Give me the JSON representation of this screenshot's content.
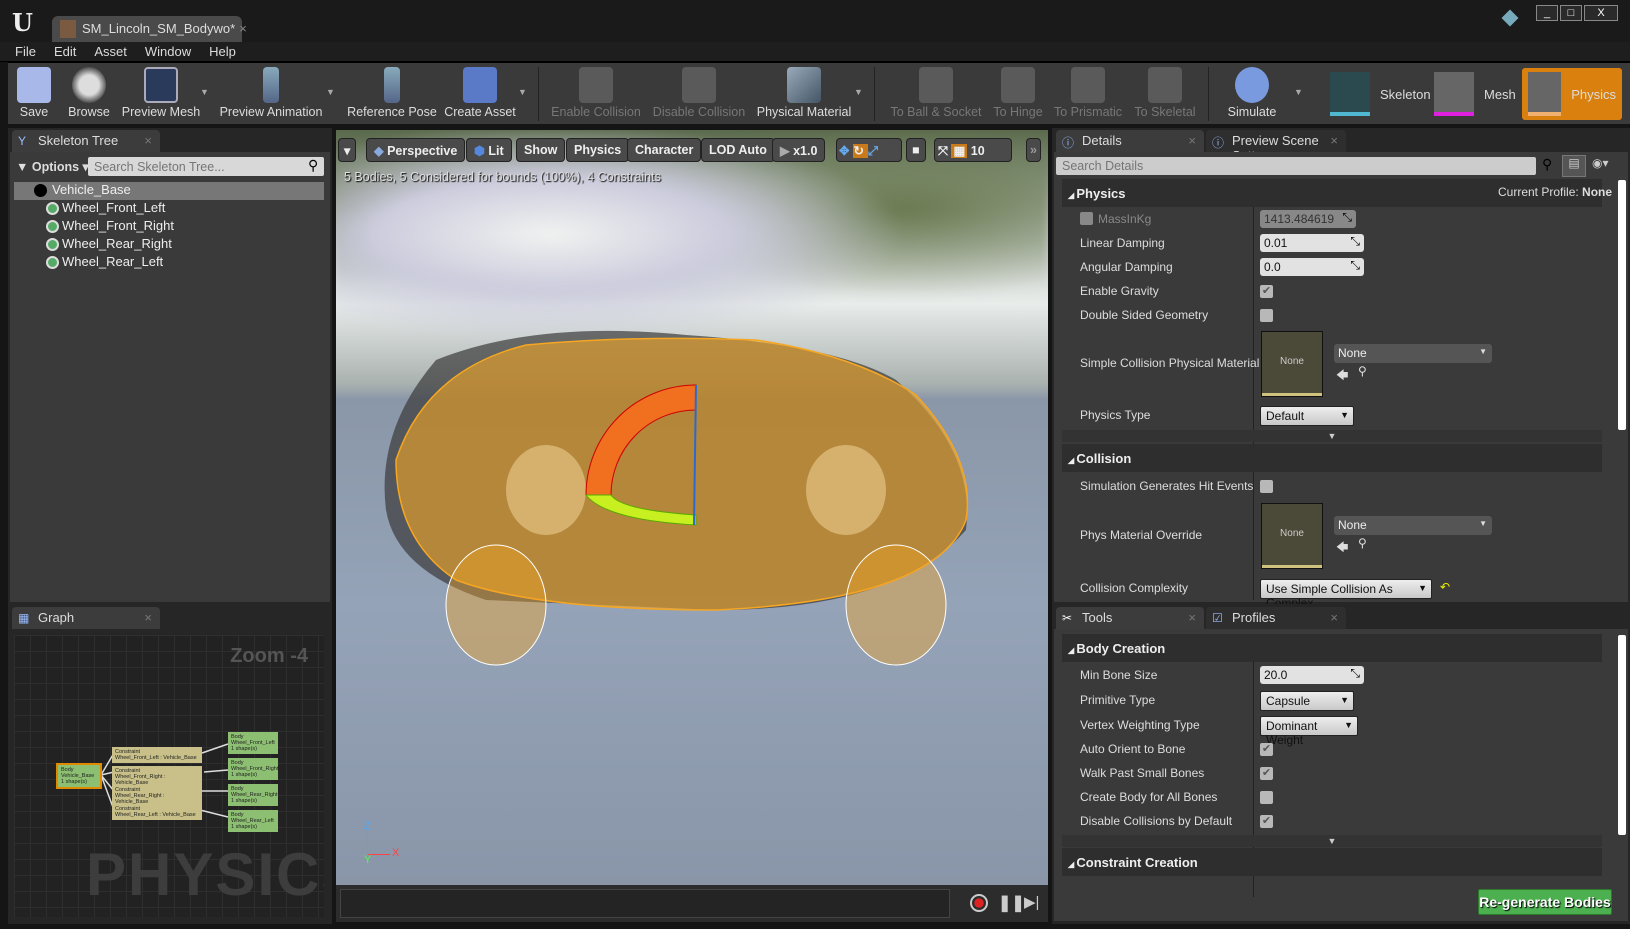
{
  "app": {
    "document_tab": "SM_Lincoln_SM_Bodywo*",
    "window_buttons": [
      "_",
      "□",
      "X"
    ]
  },
  "menu": [
    "File",
    "Edit",
    "Asset",
    "Window",
    "Help"
  ],
  "toolbar": {
    "items": [
      {
        "label": "Save",
        "icon": "save-icon",
        "enabled": true
      },
      {
        "label": "Browse",
        "icon": "browse-icon",
        "enabled": true
      },
      {
        "label": "Preview Mesh",
        "icon": "preview-mesh-icon",
        "enabled": true
      },
      {
        "label": "Preview Animation",
        "icon": "preview-animation-icon",
        "enabled": true
      },
      {
        "label": "Reference Pose",
        "icon": "reference-pose-icon",
        "enabled": true
      },
      {
        "label": "Create Asset",
        "icon": "create-asset-icon",
        "enabled": true
      },
      {
        "label": "Enable Collision",
        "icon": "enable-collision-icon",
        "enabled": false
      },
      {
        "label": "Disable Collision",
        "icon": "disable-collision-icon",
        "enabled": false
      },
      {
        "label": "Physical Material",
        "icon": "physical-material-icon",
        "enabled": true
      },
      {
        "label": "To Ball & Socket",
        "icon": "ball-socket-icon",
        "enabled": false
      },
      {
        "label": "To Hinge",
        "icon": "hinge-icon",
        "enabled": false
      },
      {
        "label": "To Prismatic",
        "icon": "prismatic-icon",
        "enabled": false
      },
      {
        "label": "To Skeletal",
        "icon": "skeletal-icon",
        "enabled": false
      },
      {
        "label": "Simulate",
        "icon": "simulate-icon",
        "enabled": true
      }
    ],
    "modes": [
      {
        "label": "Skeleton",
        "color": "#4fb8d0"
      },
      {
        "label": "Mesh",
        "color": "#e020e0"
      },
      {
        "label": "Physics",
        "color": "#f0b070",
        "active": true
      }
    ]
  },
  "skeleton_tree": {
    "tab": "Skeleton Tree",
    "options": "Options",
    "search_placeholder": "Search Skeleton Tree...",
    "bones": [
      {
        "name": "Vehicle_Base",
        "selected": true
      },
      {
        "name": "Wheel_Front_Left"
      },
      {
        "name": "Wheel_Front_Right"
      },
      {
        "name": "Wheel_Rear_Right"
      },
      {
        "name": "Wheel_Rear_Left"
      }
    ]
  },
  "graph": {
    "tab": "Graph",
    "zoom": "Zoom -4",
    "watermark": "PHYSICS",
    "root": {
      "title": "Body",
      "name": "Vehicle_Base",
      "shapes": "1 shape(s)"
    },
    "constraints": [
      {
        "title": "Constraint",
        "name": "Wheel_Front_Left : Vehicle_Base"
      },
      {
        "title": "Constraint",
        "name": "Wheel_Front_Right : Vehicle_Base"
      },
      {
        "title": "Constraint",
        "name": "Wheel_Rear_Right : Vehicle_Base"
      },
      {
        "title": "Constraint",
        "name": "Wheel_Rear_Left : Vehicle_Base"
      }
    ],
    "bodies": [
      {
        "title": "Body",
        "name": "Wheel_Front_Left",
        "shapes": "1 shape(s)"
      },
      {
        "title": "Body",
        "name": "Wheel_Front_Right",
        "shapes": "1 shape(s)"
      },
      {
        "title": "Body",
        "name": "Wheel_Rear_Right",
        "shapes": "1 shape(s)"
      },
      {
        "title": "Body",
        "name": "Wheel_Rear_Left",
        "shapes": "1 shape(s)"
      }
    ]
  },
  "viewport": {
    "buttons": {
      "perspective": "Perspective",
      "lit": "Lit",
      "show": "Show",
      "physics": "Physics",
      "character": "Character",
      "lod": "LOD Auto",
      "speed": "x1.0",
      "grid": "10"
    },
    "stats": "5 Bodies, 5 Considered for bounds (100%), 4 Constraints",
    "axis": {
      "z": "Z",
      "x": "X",
      "y": "Y"
    },
    "accent": "#f5a623"
  },
  "details": {
    "tabs": [
      "Details",
      "Preview Scene Sett"
    ],
    "search_placeholder": "Search Details",
    "physics": {
      "header": "Physics",
      "profile_label": "Current Profile:",
      "profile_value": "None",
      "mass_label": "MassInKg",
      "mass_value": "1413.484619",
      "mass_override": false,
      "linear_damping_label": "Linear Damping",
      "linear_damping": "0.01",
      "angular_damping_label": "Angular Damping",
      "angular_damping": "0.0",
      "gravity_label": "Enable Gravity",
      "gravity": true,
      "double_sided_label": "Double Sided Geometry",
      "double_sided": false,
      "simple_mat_label": "Simple Collision Physical Material",
      "simple_mat_thumb": "None",
      "simple_mat_value": "None",
      "physics_type_label": "Physics Type",
      "physics_type": "Default"
    },
    "collision": {
      "header": "Collision",
      "hit_events_label": "Simulation Generates Hit Events",
      "hit_events": false,
      "override_label": "Phys Material Override",
      "override_thumb": "None",
      "override_value": "None",
      "complexity_label": "Collision Complexity",
      "complexity": "Use Simple Collision As Complex"
    }
  },
  "tools": {
    "tabs": [
      "Tools",
      "Profiles"
    ],
    "body_creation": {
      "header": "Body Creation",
      "min_bone_label": "Min Bone Size",
      "min_bone": "20.0",
      "primitive_label": "Primitive Type",
      "primitive": "Capsule",
      "vertex_label": "Vertex Weighting Type",
      "vertex": "Dominant Weight",
      "auto_orient_label": "Auto Orient to Bone",
      "auto_orient": true,
      "walk_label": "Walk Past Small Bones",
      "walk": true,
      "all_bones_label": "Create Body for All Bones",
      "all_bones": false,
      "disable_coll_label": "Disable Collisions by Default",
      "disable_coll": true
    },
    "constraint_header": "Constraint Creation",
    "regenerate": "Re-generate Bodies",
    "regenerate_color": "#4caf50"
  }
}
